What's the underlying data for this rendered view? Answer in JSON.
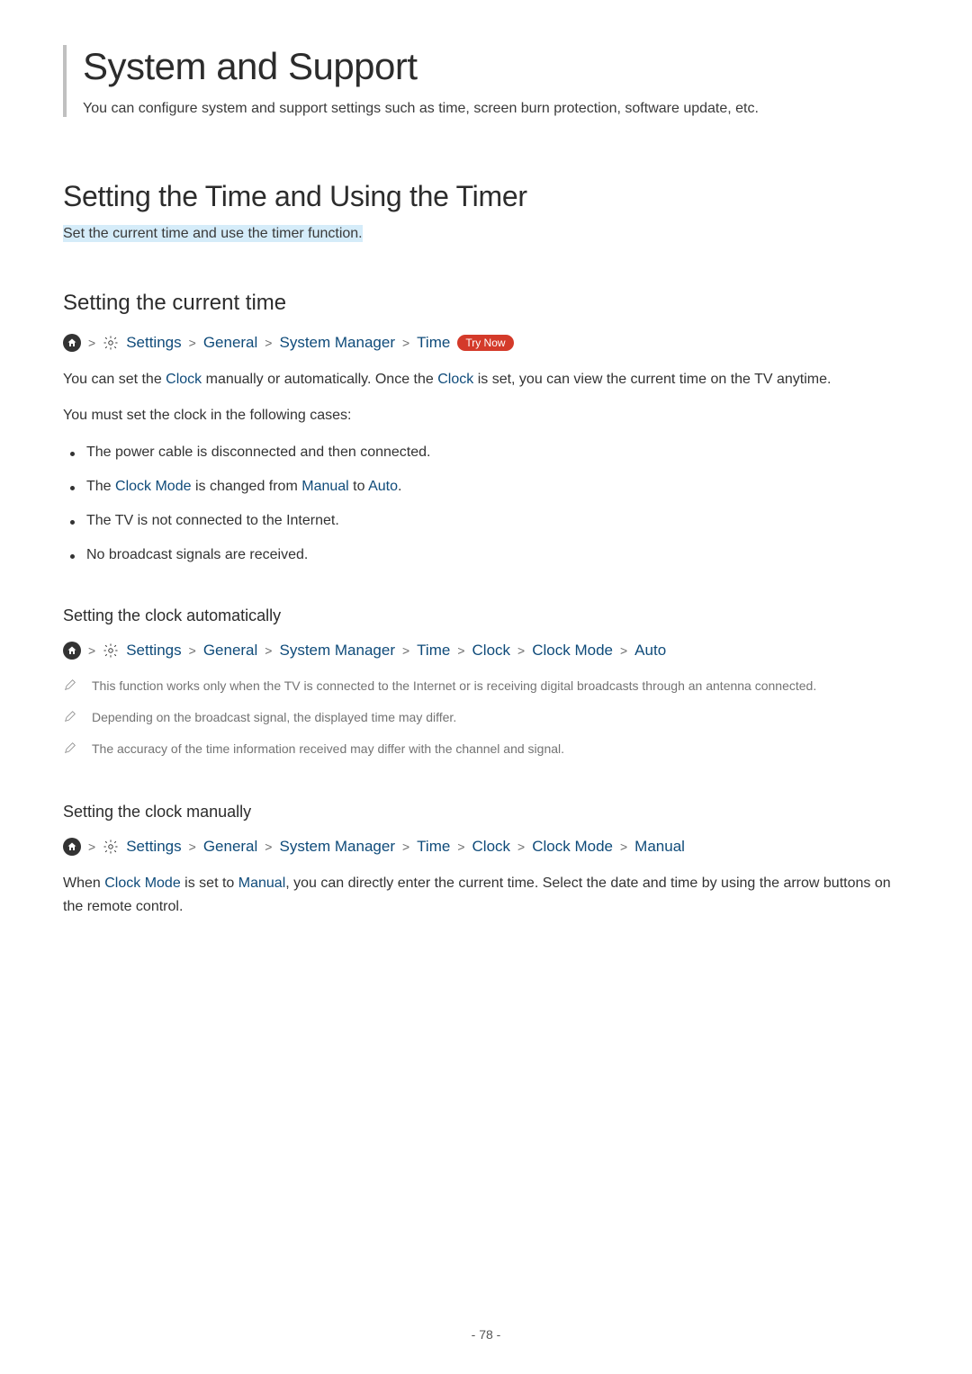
{
  "title": "System and Support",
  "intro": "You can configure system and support settings such as time, screen burn protection, software update, etc.",
  "section1": {
    "heading": "Setting the Time and Using the Timer",
    "subtext": "Set the current time and use the timer function."
  },
  "section2": {
    "heading": "Setting the current time",
    "nav": {
      "settings": "Settings",
      "general": "General",
      "sysmgr": "System Manager",
      "time": "Time",
      "trynow": "Try Now"
    },
    "p1_a": "You can set the ",
    "p1_clock1": "Clock",
    "p1_b": " manually or automatically. Once the ",
    "p1_clock2": "Clock",
    "p1_c": " is set, you can view the current time on the TV anytime.",
    "p2": "You must set the clock in the following cases:",
    "bullets": {
      "b1": "The power cable is disconnected and then connected.",
      "b2_a": "The ",
      "b2_kw1": "Clock Mode",
      "b2_b": " is changed from ",
      "b2_kw2": "Manual",
      "b2_c": " to ",
      "b2_kw3": "Auto",
      "b2_d": ".",
      "b3": "The TV is not connected to the Internet.",
      "b4": "No broadcast signals are received."
    }
  },
  "section3": {
    "heading": "Setting the clock automatically",
    "nav": {
      "settings": "Settings",
      "general": "General",
      "sysmgr": "System Manager",
      "time": "Time",
      "clock": "Clock",
      "clockmode": "Clock Mode",
      "auto": "Auto"
    },
    "notes": {
      "n1": "This function works only when the TV is connected to the Internet or is receiving digital broadcasts through an antenna connected.",
      "n2": "Depending on the broadcast signal, the displayed time may differ.",
      "n3": "The accuracy of the time information received may differ with the channel and signal."
    }
  },
  "section4": {
    "heading": "Setting the clock manually",
    "nav": {
      "settings": "Settings",
      "general": "General",
      "sysmgr": "System Manager",
      "time": "Time",
      "clock": "Clock",
      "clockmode": "Clock Mode",
      "manual": "Manual"
    },
    "p_a": "When ",
    "p_kw1": "Clock Mode",
    "p_b": " is set to ",
    "p_kw2": "Manual",
    "p_c": ", you can directly enter the current time. Select the date and time by using the arrow buttons on the remote control."
  },
  "pagenum": "- 78 -",
  "chevron": ">"
}
